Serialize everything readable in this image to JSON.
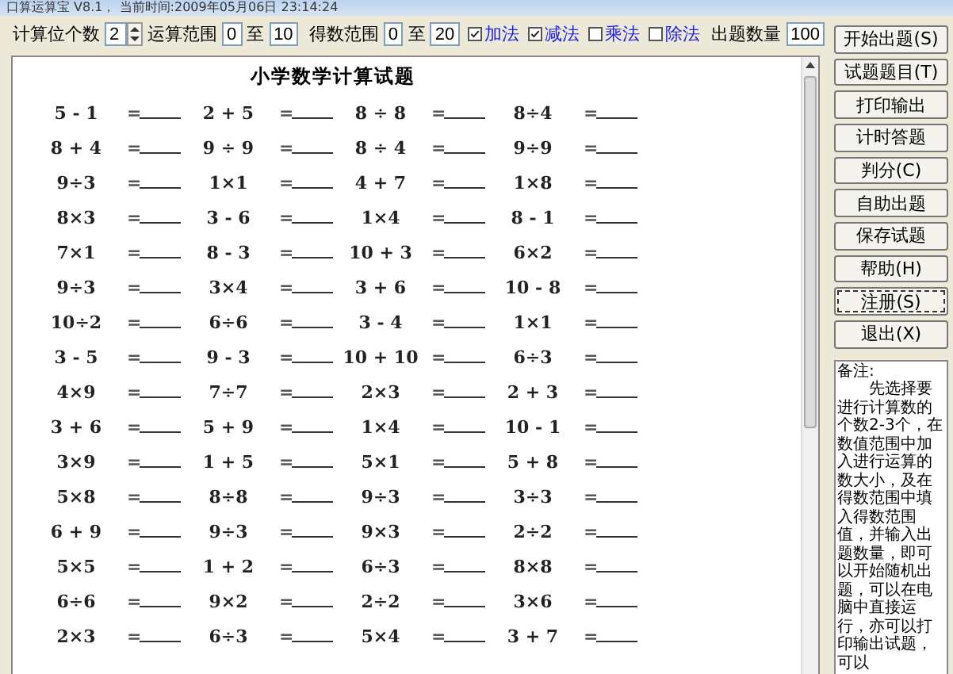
{
  "window": {
    "title": "口算运算宝 V8.1， 当前时间:2009年05月06日 23:14:24"
  },
  "toolbar": {
    "digits_label": "计算位个数",
    "digits_value": "2",
    "range_label": "运算范围",
    "range_from": "0",
    "range_to_label": "至",
    "range_to": "10",
    "result_label": "得数范围",
    "result_from": "0",
    "result_to_label": "至",
    "result_to": "20",
    "operations": [
      {
        "label": "加法",
        "checked": true
      },
      {
        "label": "减法",
        "checked": true
      },
      {
        "label": "乘法",
        "checked": false
      },
      {
        "label": "除法",
        "checked": false
      }
    ],
    "count_label": "出题数量",
    "count_value": "100"
  },
  "sheet": {
    "title": "小学数学计算试题",
    "rows": [
      [
        {
          "q": "5 - 1",
          "eq": "="
        },
        {
          "q": "2 + 5",
          "eq": "="
        },
        {
          "q": "8 ÷ 8",
          "eq": "="
        },
        {
          "q": "8÷4",
          "eq": "="
        }
      ],
      [
        {
          "q": "8 + 4",
          "eq": "="
        },
        {
          "q": "9 ÷ 9",
          "eq": "="
        },
        {
          "q": "8 ÷ 4",
          "eq": "="
        },
        {
          "q": "9÷9",
          "eq": "="
        }
      ],
      [
        {
          "q": "9÷3",
          "eq": "="
        },
        {
          "q": "1×1",
          "eq": "="
        },
        {
          "q": "4 + 7",
          "eq": "="
        },
        {
          "q": "1×8",
          "eq": "="
        }
      ],
      [
        {
          "q": "8×3",
          "eq": "="
        },
        {
          "q": "3 - 6",
          "eq": "="
        },
        {
          "q": "1×4",
          "eq": "="
        },
        {
          "q": "8 - 1",
          "eq": "="
        }
      ],
      [
        {
          "q": "7×1",
          "eq": "="
        },
        {
          "q": "8 - 3",
          "eq": "="
        },
        {
          "q": "10 + 3",
          "eq": "="
        },
        {
          "q": "6×2",
          "eq": "="
        }
      ],
      [
        {
          "q": "9÷3",
          "eq": "="
        },
        {
          "q": "3×4",
          "eq": "="
        },
        {
          "q": "3 + 6",
          "eq": "="
        },
        {
          "q": "10 - 8",
          "eq": "="
        }
      ],
      [
        {
          "q": "10÷2",
          "eq": "="
        },
        {
          "q": "6÷6",
          "eq": "="
        },
        {
          "q": "3 - 4",
          "eq": "="
        },
        {
          "q": "1×1",
          "eq": "="
        }
      ],
      [
        {
          "q": "3 - 5",
          "eq": "="
        },
        {
          "q": "9 - 3",
          "eq": "="
        },
        {
          "q": "10 + 10",
          "eq": "="
        },
        {
          "q": "6÷3",
          "eq": "="
        }
      ],
      [
        {
          "q": "4×9",
          "eq": "="
        },
        {
          "q": "7÷7",
          "eq": "="
        },
        {
          "q": "2×3",
          "eq": "="
        },
        {
          "q": "2 + 3",
          "eq": "="
        }
      ],
      [
        {
          "q": "3 + 6",
          "eq": "="
        },
        {
          "q": "5 + 9",
          "eq": "="
        },
        {
          "q": "1×4",
          "eq": "="
        },
        {
          "q": "10 - 1",
          "eq": "="
        }
      ],
      [
        {
          "q": "3×9",
          "eq": "="
        },
        {
          "q": "1 + 5",
          "eq": "="
        },
        {
          "q": "5×1",
          "eq": "="
        },
        {
          "q": "5 + 8",
          "eq": "="
        }
      ],
      [
        {
          "q": "5×8",
          "eq": "="
        },
        {
          "q": "8÷8",
          "eq": "="
        },
        {
          "q": "9÷3",
          "eq": "="
        },
        {
          "q": "3÷3",
          "eq": "="
        }
      ],
      [
        {
          "q": "6 + 9",
          "eq": "="
        },
        {
          "q": "9÷3",
          "eq": "="
        },
        {
          "q": "9×3",
          "eq": "="
        },
        {
          "q": "2÷2",
          "eq": "="
        }
      ],
      [
        {
          "q": "5×5",
          "eq": "="
        },
        {
          "q": "1 + 2",
          "eq": "="
        },
        {
          "q": "6÷3",
          "eq": "="
        },
        {
          "q": "8×8",
          "eq": "="
        }
      ],
      [
        {
          "q": "6÷6",
          "eq": "="
        },
        {
          "q": "9×2",
          "eq": "="
        },
        {
          "q": "2÷2",
          "eq": "="
        },
        {
          "q": "3×6",
          "eq": "="
        }
      ],
      [
        {
          "q": "2×3",
          "eq": "="
        },
        {
          "q": "6÷3",
          "eq": "="
        },
        {
          "q": "5×4",
          "eq": "="
        },
        {
          "q": "3 + 7",
          "eq": "="
        }
      ]
    ]
  },
  "buttons": [
    {
      "label": "开始出题(S)",
      "focused": false
    },
    {
      "label": "试题题目(T)",
      "focused": false
    },
    {
      "label": "打印输出",
      "focused": false
    },
    {
      "label": "计时答题",
      "focused": false
    },
    {
      "label": "判分(C)",
      "focused": false
    },
    {
      "label": "自助出题",
      "focused": false
    },
    {
      "label": "保存试题",
      "focused": false
    },
    {
      "label": "帮助(H)",
      "focused": false
    },
    {
      "label": "注册(S)",
      "focused": true
    },
    {
      "label": "退出(X)",
      "focused": false
    }
  ],
  "note": {
    "heading": "备注:",
    "text": "先选择要进行计算数的个数2-3个，在数值范围中加入进行运算的数大小，及在得数范围中填入得数范围值，并输入出题数量，即可以开始随机出题，可以在电脑中直接运行，亦可以打印输出试题，可以"
  }
}
